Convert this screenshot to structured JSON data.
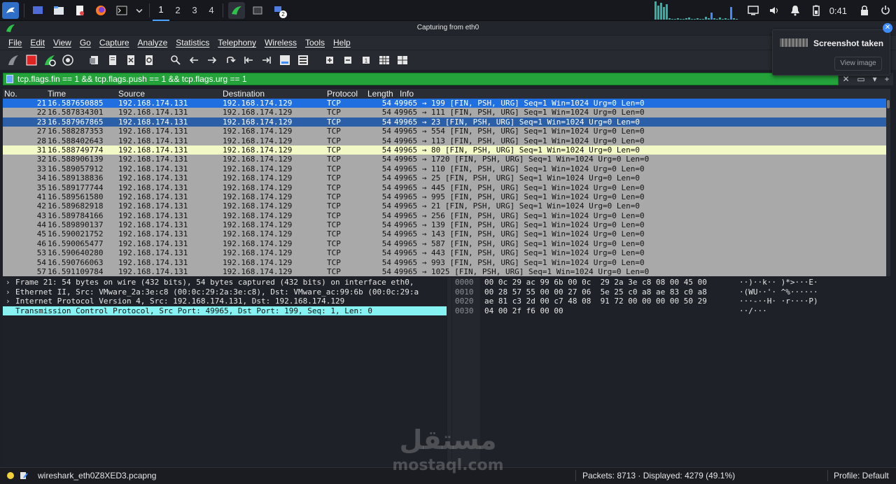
{
  "taskbar": {
    "workspaces": [
      "1",
      "2",
      "3",
      "4"
    ],
    "active_workspace": "1",
    "clock": "0:41",
    "badge_count": "2",
    "apps": [
      "kali-menu-icon",
      "desktop-icon",
      "file-manager-icon",
      "text-editor-icon",
      "firefox-icon",
      "terminal-icon"
    ]
  },
  "window": {
    "title": "Capturing from eth0"
  },
  "menu": [
    "File",
    "Edit",
    "View",
    "Go",
    "Capture",
    "Analyze",
    "Statistics",
    "Telephony",
    "Wireless",
    "Tools",
    "Help"
  ],
  "filter": {
    "value": "tcp.flags.fin == 1 && tcp.flags.push == 1 && tcp.flags.urg == 1",
    "plus": "+"
  },
  "packet_list": {
    "columns": [
      "No.",
      "Time",
      "Source",
      "Destination",
      "Protocol",
      "Length",
      "Info"
    ],
    "rows": [
      {
        "no": "21",
        "time": "16.587650885",
        "src": "192.168.174.131",
        "dst": "192.168.174.129",
        "proto": "TCP",
        "len": "54",
        "info": "49965 → 199 [FIN, PSH, URG] Seq=1 Win=1024 Urg=0 Len=0",
        "style": "sel-first"
      },
      {
        "no": "22",
        "time": "16.587834301",
        "src": "192.168.174.131",
        "dst": "192.168.174.129",
        "proto": "TCP",
        "len": "54",
        "info": "49965 → 111 [FIN, PSH, URG] Seq=1 Win=1024 Urg=0 Len=0",
        "style": ""
      },
      {
        "no": "23",
        "time": "16.587967865",
        "src": "192.168.174.131",
        "dst": "192.168.174.129",
        "proto": "TCP",
        "len": "54",
        "info": "49965 → 23 [FIN, PSH, URG] Seq=1 Win=1024 Urg=0 Len=0",
        "style": "sel"
      },
      {
        "no": "27",
        "time": "16.588287353",
        "src": "192.168.174.131",
        "dst": "192.168.174.129",
        "proto": "TCP",
        "len": "54",
        "info": "49965 → 554 [FIN, PSH, URG] Seq=1 Win=1024 Urg=0 Len=0",
        "style": ""
      },
      {
        "no": "28",
        "time": "16.588402643",
        "src": "192.168.174.131",
        "dst": "192.168.174.129",
        "proto": "TCP",
        "len": "54",
        "info": "49965 → 113 [FIN, PSH, URG] Seq=1 Win=1024 Urg=0 Len=0",
        "style": ""
      },
      {
        "no": "31",
        "time": "16.588749774",
        "src": "192.168.174.131",
        "dst": "192.168.174.129",
        "proto": "TCP",
        "len": "54",
        "info": "49965 → 80 [FIN, PSH, URG] Seq=1 Win=1024 Urg=0 Len=0",
        "style": "hl"
      },
      {
        "no": "32",
        "time": "16.588906139",
        "src": "192.168.174.131",
        "dst": "192.168.174.129",
        "proto": "TCP",
        "len": "54",
        "info": "49965 → 1720 [FIN, PSH, URG] Seq=1 Win=1024 Urg=0 Len=0",
        "style": ""
      },
      {
        "no": "33",
        "time": "16.589057912",
        "src": "192.168.174.131",
        "dst": "192.168.174.129",
        "proto": "TCP",
        "len": "54",
        "info": "49965 → 110 [FIN, PSH, URG] Seq=1 Win=1024 Urg=0 Len=0",
        "style": ""
      },
      {
        "no": "34",
        "time": "16.589138836",
        "src": "192.168.174.131",
        "dst": "192.168.174.129",
        "proto": "TCP",
        "len": "54",
        "info": "49965 → 25 [FIN, PSH, URG] Seq=1 Win=1024 Urg=0 Len=0",
        "style": ""
      },
      {
        "no": "35",
        "time": "16.589177744",
        "src": "192.168.174.131",
        "dst": "192.168.174.129",
        "proto": "TCP",
        "len": "54",
        "info": "49965 → 445 [FIN, PSH, URG] Seq=1 Win=1024 Urg=0 Len=0",
        "style": ""
      },
      {
        "no": "41",
        "time": "16.589561580",
        "src": "192.168.174.131",
        "dst": "192.168.174.129",
        "proto": "TCP",
        "len": "54",
        "info": "49965 → 995 [FIN, PSH, URG] Seq=1 Win=1024 Urg=0 Len=0",
        "style": ""
      },
      {
        "no": "42",
        "time": "16.589682918",
        "src": "192.168.174.131",
        "dst": "192.168.174.129",
        "proto": "TCP",
        "len": "54",
        "info": "49965 → 21 [FIN, PSH, URG] Seq=1 Win=1024 Urg=0 Len=0",
        "style": ""
      },
      {
        "no": "43",
        "time": "16.589784166",
        "src": "192.168.174.131",
        "dst": "192.168.174.129",
        "proto": "TCP",
        "len": "54",
        "info": "49965 → 256 [FIN, PSH, URG] Seq=1 Win=1024 Urg=0 Len=0",
        "style": ""
      },
      {
        "no": "44",
        "time": "16.589890137",
        "src": "192.168.174.131",
        "dst": "192.168.174.129",
        "proto": "TCP",
        "len": "54",
        "info": "49965 → 139 [FIN, PSH, URG] Seq=1 Win=1024 Urg=0 Len=0",
        "style": ""
      },
      {
        "no": "45",
        "time": "16.590021752",
        "src": "192.168.174.131",
        "dst": "192.168.174.129",
        "proto": "TCP",
        "len": "54",
        "info": "49965 → 143 [FIN, PSH, URG] Seq=1 Win=1024 Urg=0 Len=0",
        "style": ""
      },
      {
        "no": "46",
        "time": "16.590065477",
        "src": "192.168.174.131",
        "dst": "192.168.174.129",
        "proto": "TCP",
        "len": "54",
        "info": "49965 → 587 [FIN, PSH, URG] Seq=1 Win=1024 Urg=0 Len=0",
        "style": ""
      },
      {
        "no": "53",
        "time": "16.590640280",
        "src": "192.168.174.131",
        "dst": "192.168.174.129",
        "proto": "TCP",
        "len": "54",
        "info": "49965 → 443 [FIN, PSH, URG] Seq=1 Win=1024 Urg=0 Len=0",
        "style": ""
      },
      {
        "no": "54",
        "time": "16.590766063",
        "src": "192.168.174.131",
        "dst": "192.168.174.129",
        "proto": "TCP",
        "len": "54",
        "info": "49965 → 993 [FIN, PSH, URG] Seq=1 Win=1024 Urg=0 Len=0",
        "style": ""
      },
      {
        "no": "57",
        "time": "16.591109784",
        "src": "192.168.174.131",
        "dst": "192.168.174.129",
        "proto": "TCP",
        "len": "54",
        "info": "49965 → 1025 [FIN, PSH, URG] Seq=1 Win=1024 Urg=0 Len=0",
        "style": ""
      }
    ]
  },
  "details": [
    {
      "text": "Frame 21: 54 bytes on wire (432 bits), 54 bytes captured (432 bits) on interface eth0,",
      "selected": false
    },
    {
      "text": "Ethernet II, Src: VMware_2a:3e:c8 (00:0c:29:2a:3e:c8), Dst: VMware_ac:99:6b (00:0c:29:a",
      "selected": false
    },
    {
      "text": "Internet Protocol Version 4, Src: 192.168.174.131, Dst: 192.168.174.129",
      "selected": false
    },
    {
      "text": "Transmission Control Protocol, Src Port: 49965, Dst Port: 199, Seq: 1, Len: 0",
      "selected": true
    }
  ],
  "bytes": [
    {
      "offset": "0000",
      "hex": "00 0c 29 ac 99 6b 00 0c  29 2a 3e c8 08 00 45 00",
      "ascii": "··)··k·· )*>···E·"
    },
    {
      "offset": "0010",
      "hex": "00 28 57 55 00 00 27 06  5e 25 c0 a8 ae 83 c0 a8",
      "ascii": "·(WU··'· ^%······"
    },
    {
      "offset": "0020",
      "hex": "ae 81 c3 2d 00 c7 48 08  91 72 00 00 00 00 50 29",
      "ascii": "···-··H· ·r····P)"
    },
    {
      "offset": "0030",
      "hex": "04 00 2f f6 00 00",
      "ascii": "··/···"
    }
  ],
  "status": {
    "file": "wireshark_eth0Z8XED3.pcapng",
    "packets": "Packets: 8713 · Displayed: 4279 (49.1%)",
    "profile": "Profile: Default"
  },
  "notification": {
    "title": "Screenshot taken",
    "button": "View image"
  },
  "watermark": {
    "text_ar": "مستقل",
    "text_en": "mostaql.com"
  },
  "colors": {
    "filter_valid": "#23a33a",
    "row_selected": "#2b5fa8",
    "row_highlight": "#f3f9c6",
    "detail_selected": "#86f2f2"
  }
}
